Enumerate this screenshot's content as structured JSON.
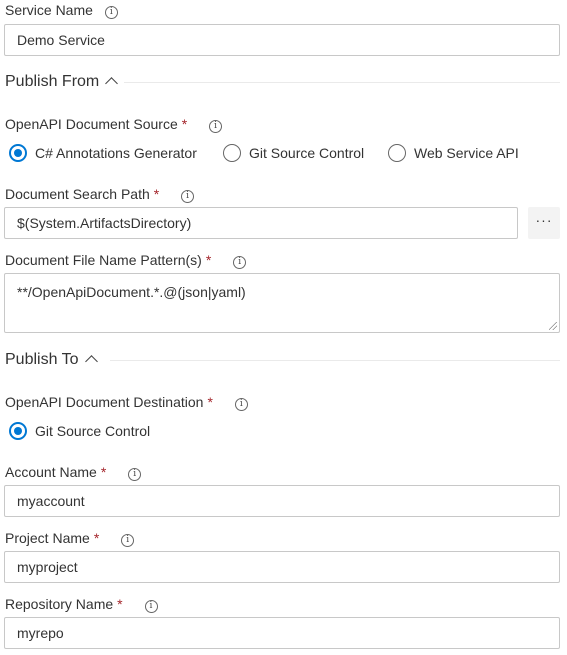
{
  "service_name": {
    "label": "Service Name",
    "value": "Demo Service"
  },
  "publish_from": {
    "title": "Publish From",
    "source": {
      "label": "OpenAPI Document Source",
      "required_mark": "*",
      "options": [
        "C# Annotations Generator",
        "Git Source Control",
        "Web Service API"
      ],
      "selected": "C# Annotations Generator"
    },
    "search_path": {
      "label": "Document Search Path",
      "required_mark": "*",
      "value": "$(System.ArtifactsDirectory)",
      "browse_label": "···"
    },
    "file_pattern": {
      "label": "Document File Name Pattern(s)",
      "required_mark": "*",
      "value": "**/OpenApiDocument.*.@(json|yaml)"
    }
  },
  "publish_to": {
    "title": "Publish To",
    "destination": {
      "label": "OpenAPI Document Destination",
      "required_mark": "*",
      "options": [
        "Git Source Control"
      ],
      "selected": "Git Source Control"
    },
    "account": {
      "label": "Account Name",
      "required_mark": "*",
      "value": "myaccount"
    },
    "project": {
      "label": "Project Name",
      "required_mark": "*",
      "value": "myproject"
    },
    "repository": {
      "label": "Repository Name",
      "required_mark": "*",
      "value": "myrepo"
    }
  },
  "info_glyph": "i",
  "colors": {
    "accent": "#0078d4",
    "required": "#a4262c",
    "border": "#c8c8c8"
  }
}
